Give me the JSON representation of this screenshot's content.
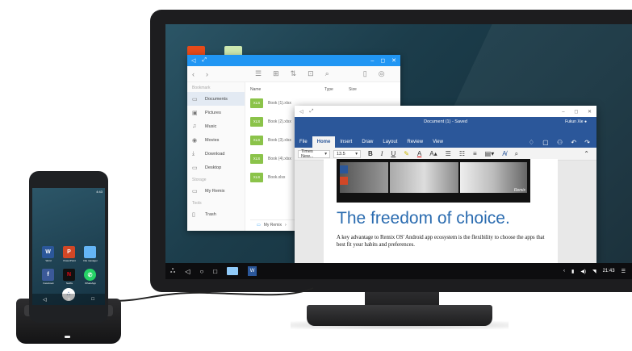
{
  "file_manager": {
    "sidebar_bookmark_heading": "Bookmark",
    "sidebar_storage_heading": "Storage",
    "sidebar_tools_heading": "Tools",
    "sidebar_items": [
      {
        "label": "Documents",
        "icon": "folder-icon"
      },
      {
        "label": "Pictures",
        "icon": "image-icon"
      },
      {
        "label": "Music",
        "icon": "music-icon"
      },
      {
        "label": "Movies",
        "icon": "movie-icon"
      },
      {
        "label": "Download",
        "icon": "download-icon"
      },
      {
        "label": "Desktop",
        "icon": "desktop-icon"
      }
    ],
    "storage_item": "My Remix",
    "tools_item": "Trash",
    "columns": {
      "name": "Name",
      "type": "Type",
      "size": "Size"
    },
    "files": [
      {
        "badge": "XLS",
        "name": "Book (1).xlsx"
      },
      {
        "badge": "XLS",
        "name": "Book (2).xlsx"
      },
      {
        "badge": "XLS",
        "name": "Book (3).xlsx"
      },
      {
        "badge": "XLS",
        "name": "Book (4).xlsx"
      },
      {
        "badge": "XLS",
        "name": "Book.xlsx"
      }
    ],
    "path": "My Remix",
    "accent": "#2196f3"
  },
  "word": {
    "doc_title": "Document (1) - Saved",
    "user": "Fukun Xie",
    "tabs": [
      "File",
      "Home",
      "Insert",
      "Draw",
      "Layout",
      "Review",
      "View"
    ],
    "active_tab": "Home",
    "font_name": "Times New...",
    "font_size": "13.5",
    "headline": "The freedom of choice.",
    "body": "A key advantage to Remix OS' Android app ecosystem is the flexibility to choose the apps that best fit your habits and preferences.",
    "photo_caption": "Remix",
    "accent": "#2b579a",
    "headline_color": "#2b6cb0"
  },
  "taskbar": {
    "time": "21:43"
  },
  "phone": {
    "status": "4:43",
    "apps": [
      {
        "label": "Word",
        "glyph": "W",
        "color": "#2b579a"
      },
      {
        "label": "PowerPoint",
        "glyph": "P",
        "color": "#d24726"
      },
      {
        "label": "File manager",
        "glyph": "",
        "color": "#64b5f6"
      },
      {
        "label": "Facebook",
        "glyph": "f",
        "color": "#3b5998"
      },
      {
        "label": "Netflix",
        "glyph": "N",
        "color": "#111111"
      },
      {
        "label": "WhatsApp",
        "glyph": "✆",
        "color": "#25d366"
      }
    ]
  }
}
